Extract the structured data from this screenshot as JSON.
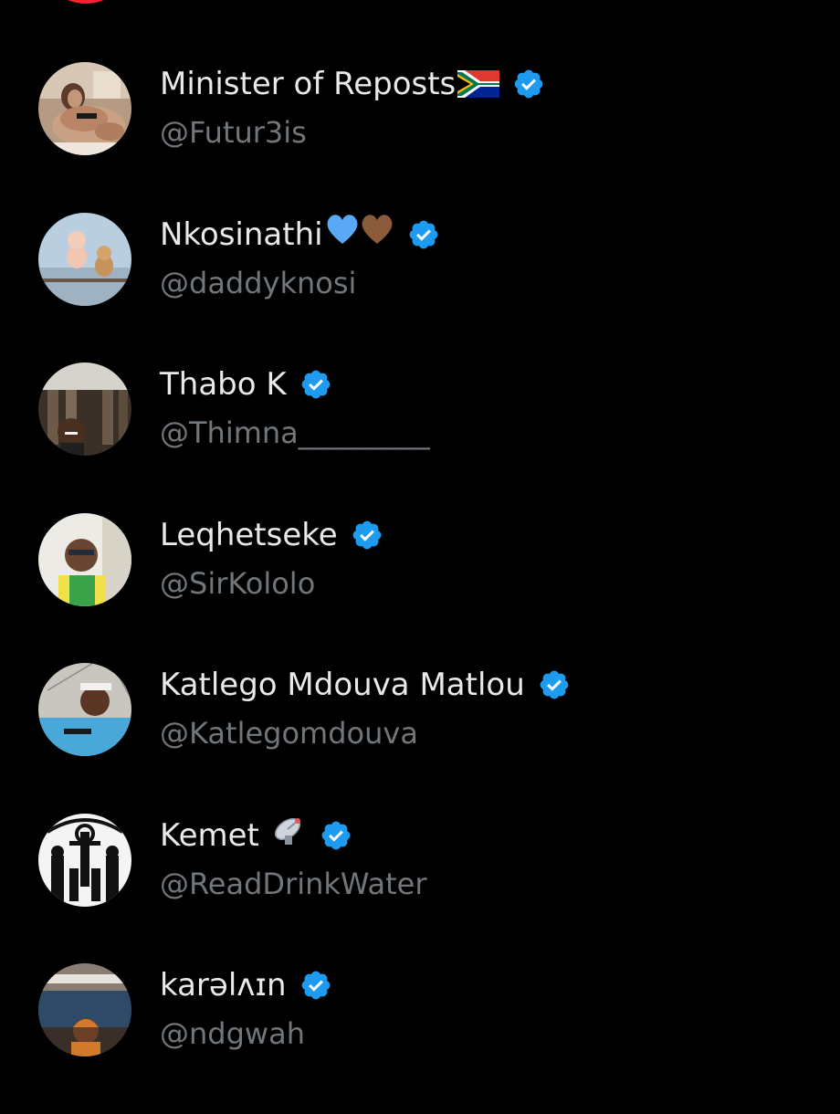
{
  "accounts": [
    {
      "name": "Minister of Reposts",
      "emoji": "🇿🇦",
      "emoji_icon": "south-africa-flag-icon",
      "handle": "@Futur3is",
      "verified": true
    },
    {
      "name": "Nkosinathi",
      "emoji": "💙🤎",
      "emoji_icon": "hearts-icon",
      "handle": "@daddyknosi",
      "verified": true
    },
    {
      "name": "Thabo K",
      "emoji": "",
      "handle": "@Thimna_________",
      "verified": true
    },
    {
      "name": "Leqhetseke",
      "emoji": "",
      "handle": "@SirKololo",
      "verified": true
    },
    {
      "name": "Katlego Mdouva Matlou",
      "emoji": "",
      "handle": "@Katlegomdouva",
      "verified": true
    },
    {
      "name": "Kemet",
      "emoji": "📡",
      "emoji_icon": "satellite-dish-icon",
      "handle": "@ReadDrinkWater",
      "verified": true
    },
    {
      "name": "karəlʌɪn",
      "emoji": "",
      "handle": "@ndgwah",
      "verified": true
    }
  ],
  "colors": {
    "background": "#000000",
    "name_text": "#e7e9ea",
    "handle_text": "#71767b",
    "verified_badge": "#1d9bf0",
    "top_partial_avatar": "#f4212e"
  }
}
